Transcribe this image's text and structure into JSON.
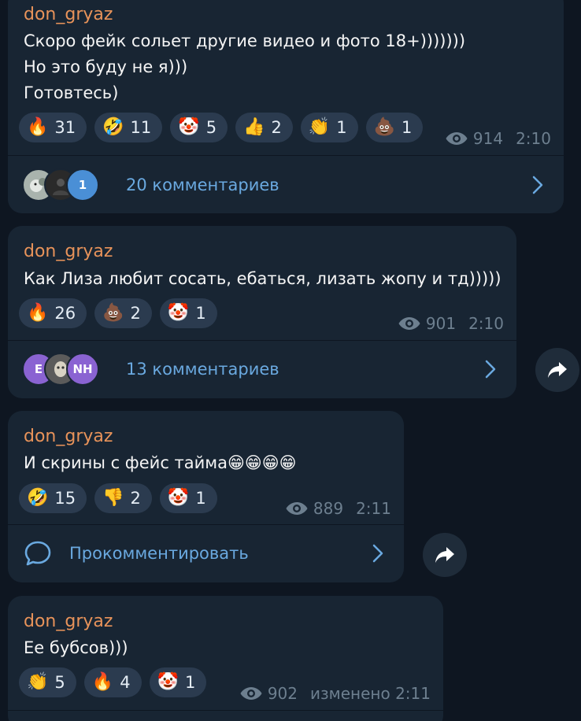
{
  "colors": {
    "background": "#0e1621",
    "bubble": "#182533",
    "author": "#e8935a",
    "link": "#6aa9e0",
    "meta": "#6d7f8f",
    "reaction_pill": "#2b3b4f"
  },
  "posts": [
    {
      "author": "don_gryaz",
      "text": "Скоро фейк сольет другие видео и фото 18+)))))))\nНо это буду не я)))\nГотовтесь)",
      "reactions": [
        {
          "emoji": "🔥",
          "count": "31"
        },
        {
          "emoji": "🤣",
          "count": "11"
        },
        {
          "emoji": "🤡",
          "count": "5"
        },
        {
          "emoji": "👍",
          "count": "2"
        },
        {
          "emoji": "👏",
          "count": "1"
        },
        {
          "emoji": "💩",
          "count": "1"
        }
      ],
      "views": "914",
      "time": "2:10",
      "comments_label": "20 комментариев",
      "avatars": [
        {
          "icon": "squirrel-avatar",
          "text": "",
          "color": "#a9b3ad"
        },
        {
          "icon": "person-avatar",
          "text": "",
          "color": "#2a2a2a"
        },
        {
          "icon": "letter-avatar",
          "text": "1",
          "color": "#4a8fd6"
        }
      ]
    },
    {
      "author": "don_gryaz",
      "text": "Как Лиза любит сосать, ебаться, лизать жопу и тд)))))",
      "reactions": [
        {
          "emoji": "🔥",
          "count": "26"
        },
        {
          "emoji": "💩",
          "count": "2"
        },
        {
          "emoji": "🤡",
          "count": "1"
        }
      ],
      "views": "901",
      "time": "2:10",
      "comments_label": "13 комментариев",
      "avatars": [
        {
          "icon": "letter-avatar",
          "text": "E",
          "color": "#8a63d2"
        },
        {
          "icon": "mask-avatar",
          "text": "",
          "color": "#5b5b5b"
        },
        {
          "icon": "letter-avatar",
          "text": "NH",
          "color": "#8a63d2"
        }
      ]
    },
    {
      "author": "don_gryaz",
      "text": "И скрины с фейс тайма😁😁😁😁",
      "reactions": [
        {
          "emoji": "🤣",
          "count": "15"
        },
        {
          "emoji": "👎",
          "count": "2"
        },
        {
          "emoji": "🤡",
          "count": "1"
        }
      ],
      "views": "889",
      "time": "2:11",
      "comment_action": "Прокомментировать"
    },
    {
      "author": "don_gryaz",
      "text": "Ее бубсов)))",
      "reactions": [
        {
          "emoji": "👏",
          "count": "5"
        },
        {
          "emoji": "🔥",
          "count": "4"
        },
        {
          "emoji": "🤡",
          "count": "1"
        }
      ],
      "views": "902",
      "time": "изменено 2:11"
    }
  ]
}
